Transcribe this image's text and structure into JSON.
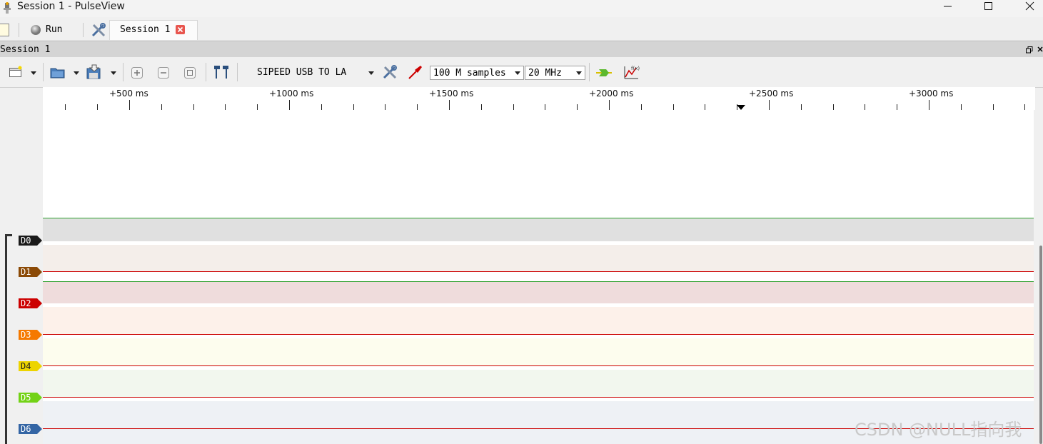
{
  "window": {
    "title": "Session 1 - PulseView",
    "controls": [
      "minimize",
      "maximize",
      "close"
    ]
  },
  "main_toolbar": {
    "run_label": "Run",
    "session_tab_label": "Session 1"
  },
  "dock": {
    "title": "Session 1"
  },
  "view_toolbar": {
    "device_label": "SIPEED USB TO LA",
    "samples_value": "100 M samples",
    "samplerate_value": "20 MHz"
  },
  "ruler": {
    "ticks": [
      "+500 ms",
      "+1000 ms",
      "+1500 ms",
      "+2000 ms",
      "+2500 ms",
      "+3000 ms"
    ]
  },
  "channels": [
    {
      "name": "D0",
      "color": "#1a1a1a"
    },
    {
      "name": "D1",
      "color": "#8b4a06"
    },
    {
      "name": "D2",
      "color": "#cc0000"
    },
    {
      "name": "D3",
      "color": "#f57900"
    },
    {
      "name": "D4",
      "color": "#edd400"
    },
    {
      "name": "D5",
      "color": "#73d216"
    },
    {
      "name": "D6",
      "color": "#3465a4"
    }
  ],
  "watermark": "CSDN @NULL指向我"
}
